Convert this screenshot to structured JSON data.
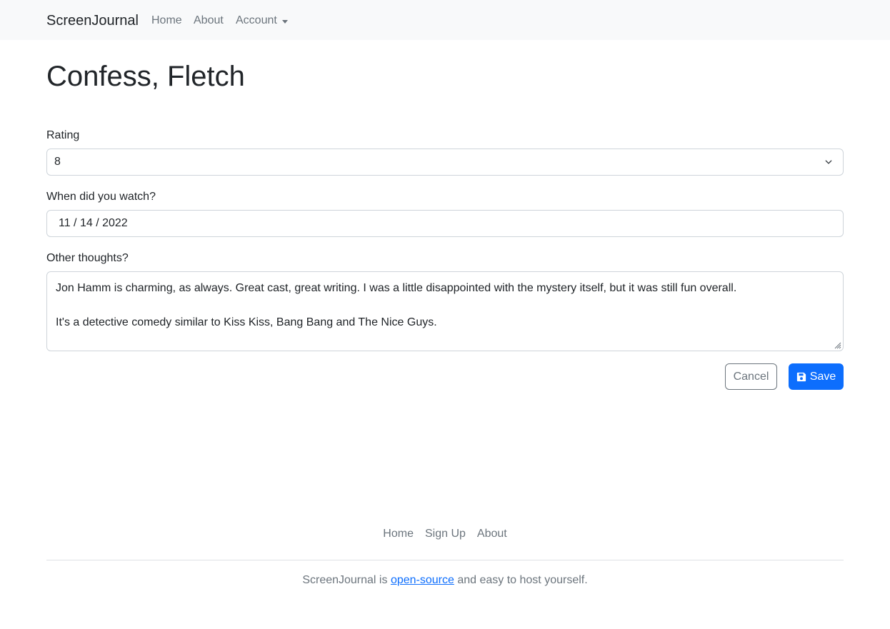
{
  "navbar": {
    "brand": "ScreenJournal",
    "links": {
      "home": "Home",
      "about": "About",
      "account": "Account"
    }
  },
  "page": {
    "title": "Confess, Fletch"
  },
  "form": {
    "rating": {
      "label": "Rating",
      "value": "8"
    },
    "watch_date": {
      "label": "When did you watch?",
      "value": "11 / 14 / 2022"
    },
    "thoughts": {
      "label": "Other thoughts?",
      "line1": "Jon Hamm is charming, as always. Great cast, great writing. I was a little disappointed with the mystery itself, but it was still fun overall.",
      "line2": "It's a detective comedy similar to Kiss Kiss, Bang Bang and The Nice Guys."
    },
    "cancel_label": "Cancel",
    "save_label": "Save"
  },
  "footer": {
    "links": {
      "home": "Home",
      "signup": "Sign Up",
      "about": "About"
    },
    "text_prefix": "ScreenJournal is ",
    "link_text": "open-source",
    "text_suffix": " and easy to host yourself."
  },
  "colors": {
    "primary": "#0d6efd",
    "muted": "#6c757d",
    "navbar_bg": "#f8f9fa"
  },
  "icons": {
    "save": "floppy-disk-icon",
    "dropdown": "chevron-down-icon",
    "caret": "caret-down-icon"
  }
}
